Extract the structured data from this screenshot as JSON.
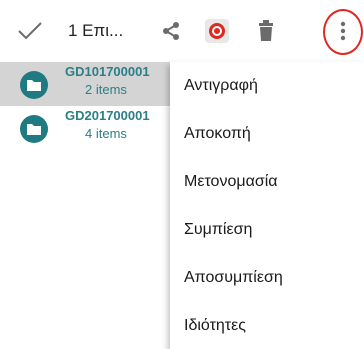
{
  "toolbar": {
    "selection_label": "1 Επι...",
    "icons": [
      "check-icon",
      "share-icon",
      "shortcut-icon",
      "trash-icon",
      "more-vertical-icon"
    ],
    "highlight_color": "#e0271f"
  },
  "list": {
    "items": [
      {
        "name": "GD101700001",
        "meta": "2 items",
        "selected": true
      },
      {
        "name": "GD201700001",
        "meta": "4 items",
        "selected": false
      }
    ],
    "accent": "#2b7f86"
  },
  "menu": {
    "items": [
      {
        "label": "Αντιγραφή"
      },
      {
        "label": "Αποκοπή"
      },
      {
        "label": "Μετονομασία"
      },
      {
        "label": "Συμπίεση"
      },
      {
        "label": "Αποσυμπίεση"
      },
      {
        "label": "Ιδιότητες"
      }
    ]
  }
}
